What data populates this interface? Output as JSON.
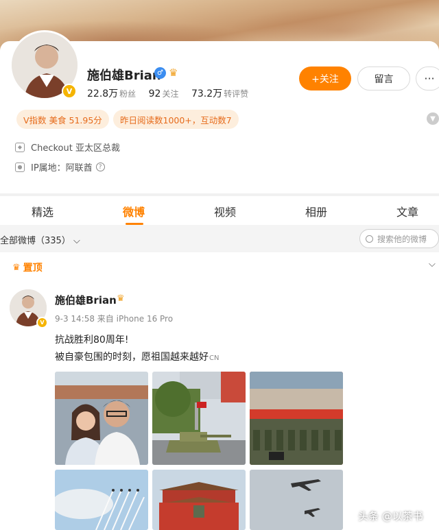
{
  "profile": {
    "name": "施伯雄Brian",
    "fans_count": "22.8万",
    "fans_label": "粉丝",
    "following_count": "92",
    "following_label": "关注",
    "reposts_count": "73.2万",
    "reposts_label": "转评赞",
    "follow_label": "+关注",
    "message_label": "留言",
    "more_label": "···",
    "tag_index": "V指数 美食 51.95分",
    "tag_reads": "昨日阅读数1000+，互动数7",
    "work": "Checkout 亚太区总裁",
    "ip": "IP属地：阿联酋"
  },
  "tabs": [
    "精选",
    "微博",
    "视频",
    "相册",
    "文章"
  ],
  "active_tab_index": 1,
  "filter": {
    "label": "全部微博（335）",
    "search_placeholder": "搜索他的微博"
  },
  "feed": {
    "pinned_label": "置顶",
    "post": {
      "author": "施伯雄Brian",
      "meta": "9-3 14:58  来自 iPhone 16 Pro",
      "line1": "抗战胜利80周年!",
      "line2": "被自豪包围的时刻，愿祖国越来越好",
      "cn_mark": "CN"
    }
  },
  "watermark": "头条 @以茶书",
  "colors": {
    "accent": "#ff8200",
    "tag_bg": "#fdeedd",
    "tag_text": "#e66b1b",
    "verified": "#3b8df0"
  }
}
